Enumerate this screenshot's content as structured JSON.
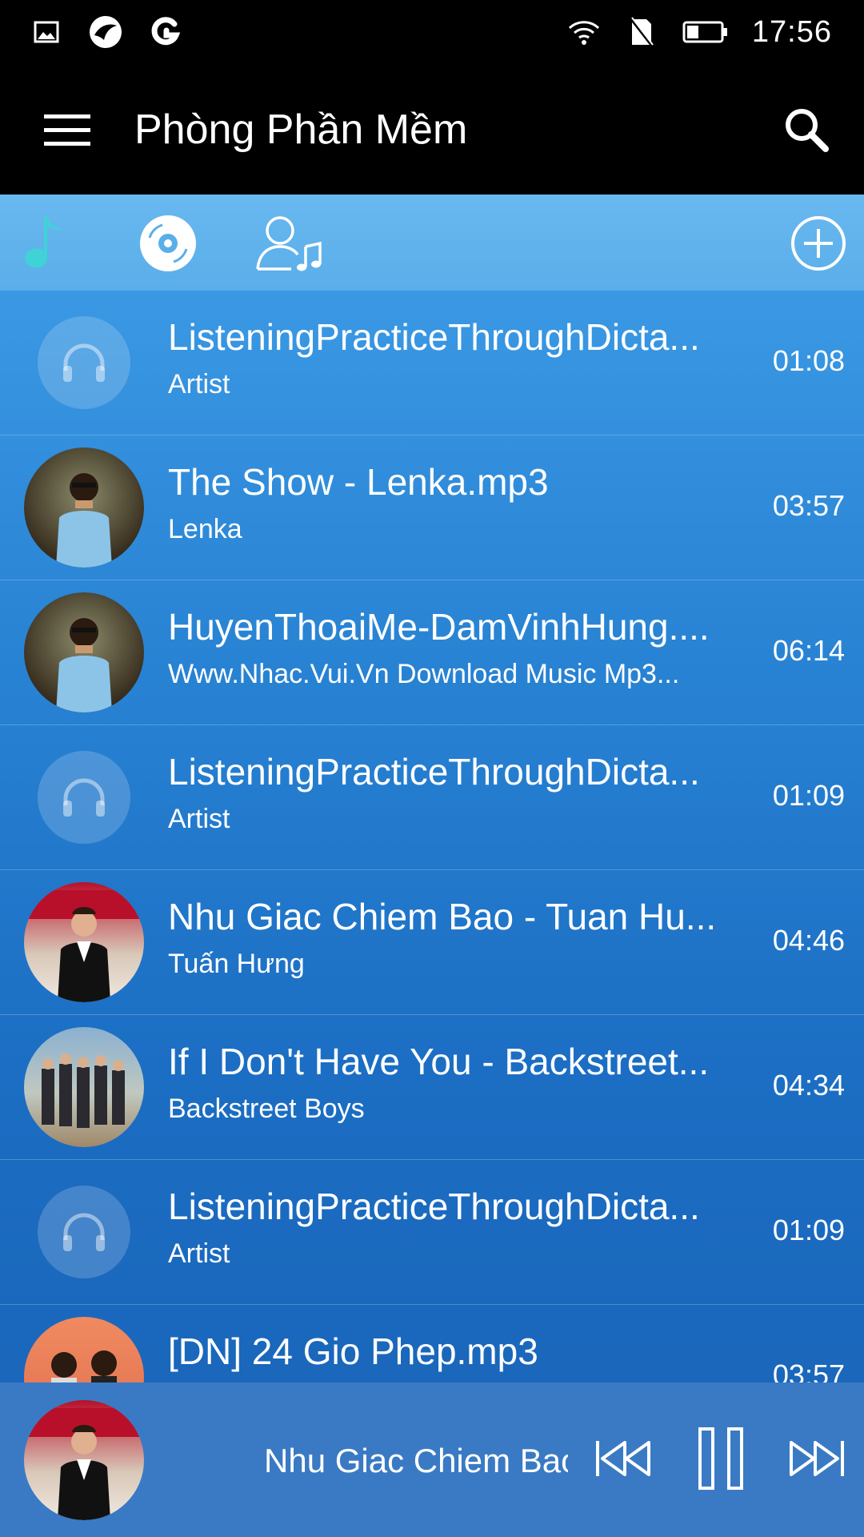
{
  "status_bar": {
    "left_icons": [
      "image-icon",
      "app-logo-icon",
      "g-logo-icon"
    ],
    "right_icons": [
      "wifi-icon",
      "no-sim-icon",
      "battery-icon"
    ],
    "time": "17:56"
  },
  "app_bar": {
    "title": "Phòng Phần Mềm",
    "menu_icon": "hamburger-menu-icon",
    "search_icon": "search-icon"
  },
  "tabs": [
    {
      "name": "songs",
      "icon": "music-note-icon",
      "active": true
    },
    {
      "name": "albums",
      "icon": "disc-icon",
      "active": false
    },
    {
      "name": "artists",
      "icon": "artist-icon",
      "active": false
    },
    {
      "name": "add",
      "icon": "add-circle-icon",
      "active": false
    }
  ],
  "songs": [
    {
      "title": "ListeningPracticeThroughDicta...",
      "artist": "Artist",
      "duration": "01:08",
      "thumb": "placeholder"
    },
    {
      "title": "The Show - Lenka.mp3",
      "artist": "Lenka",
      "duration": "03:57",
      "thumb": "photo-boy"
    },
    {
      "title": "HuyenThoaiMe-DamVinhHung....",
      "artist": "Www.Nhac.Vui.Vn Download Music Mp3...",
      "duration": "06:14",
      "thumb": "photo-boy"
    },
    {
      "title": "ListeningPracticeThroughDicta...",
      "artist": "Artist",
      "duration": "01:09",
      "thumb": "placeholder"
    },
    {
      "title": "Nhu Giac Chiem Bao - Tuan Hu...",
      "artist": "Tuấn Hưng",
      "duration": "04:46",
      "thumb": "photo-singer"
    },
    {
      "title": "If I Don't Have You - Backstreet...",
      "artist": "Backstreet Boys",
      "duration": "04:34",
      "thumb": "photo-band"
    },
    {
      "title": "ListeningPracticeThroughDicta...",
      "artist": "Artist",
      "duration": "01:09",
      "thumb": "placeholder"
    },
    {
      "title": "[DN] 24 Gio Phep.mp3",
      "artist": "",
      "duration": "03:57",
      "thumb": "photo-duo"
    }
  ],
  "player": {
    "title": "Nhu Giac Chiem Bao",
    "controls": [
      "previous-icon",
      "pause-icon",
      "next-icon"
    ]
  },
  "colors": {
    "accent": "#3fd3d8",
    "bar_bg": "#000000",
    "list_top": "#3f9ee8",
    "list_bottom": "#1a63b8"
  }
}
